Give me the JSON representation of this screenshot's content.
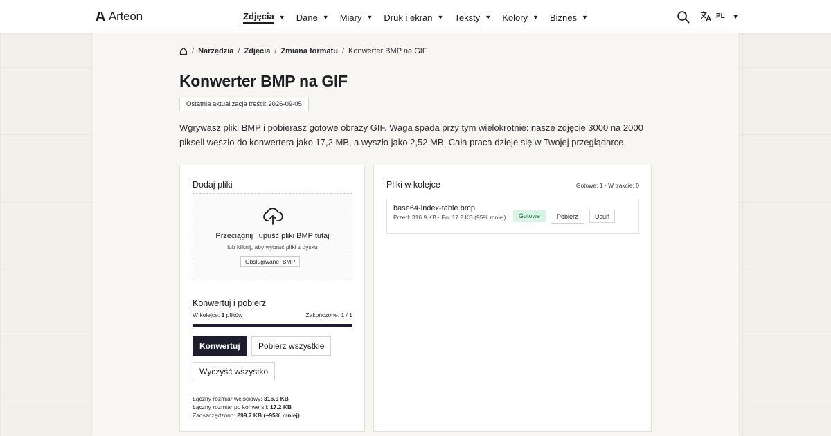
{
  "header": {
    "brand": "Arteon",
    "nav": [
      {
        "label": "Zdjęcia",
        "active": true
      },
      {
        "label": "Dane"
      },
      {
        "label": "Miary"
      },
      {
        "label": "Druk i ekran"
      },
      {
        "label": "Teksty"
      },
      {
        "label": "Kolory"
      },
      {
        "label": "Biznes"
      }
    ],
    "language": "PL"
  },
  "breadcrumb": [
    "Narzędzia",
    "Zdjęcia",
    "Zmiana formatu",
    "Konwerter BMP na GIF"
  ],
  "page": {
    "title": "Konwerter BMP na GIF",
    "updated": "Ostatnia aktualizacja treści: 2026-09-05",
    "intro": "Wgrywasz pliki BMP i pobierasz gotowe obrazy GIF. Waga spada przy tym wielokrotnie: nasze zdjęcie 3000 na 2000 pikseli weszło do konwertera jako 17,2 MB, a wyszło jako 2,52 MB. Cała praca dzieje się w Twojej przeglądarce."
  },
  "upload": {
    "title": "Dodaj pliki",
    "drop_main": "Przeciągnij i upuść pliki BMP tutaj",
    "drop_sub": "lub kliknij, aby wybrać pliki z dysku",
    "supported": "Obsługiwane: BMP"
  },
  "convert": {
    "title": "Konwertuj i pobierz",
    "queue_prefix": "W kolejce: ",
    "queue_count": "1",
    "queue_suffix": " plików",
    "done_label": "Zakończone: 1 / 1",
    "progress": 1.0,
    "convert_button": "Konwertuj",
    "download_all_button": "Pobierz wszystkie",
    "clear_all_button": "Wyczyść wszystko",
    "stats": {
      "input_label": "Łączny rozmiar wejściowy: ",
      "input_value": "316.9 KB",
      "output_label": "Łączny rozmiar po konwersji: ",
      "output_value": "17.2 KB",
      "saved_label": "Zaoszczędzono: ",
      "saved_value": "299.7 KB (~95% mniej)"
    }
  },
  "queue": {
    "title": "Pliki w kolejce",
    "status": "Gotowe: 1 · W trakcie: 0",
    "files": [
      {
        "name": "base64-index-table.bmp",
        "sizes": "Przed: 316.9 KB · Po: 17.2 KB (95% mniej)",
        "status": "Gotowe",
        "download": "Pobierz",
        "remove": "Usuń"
      }
    ]
  },
  "colors": {
    "primary": "#1d1d2e",
    "success_bg": "#d6f5e6",
    "success_text": "#1d6a46",
    "background": "#f3efea"
  }
}
